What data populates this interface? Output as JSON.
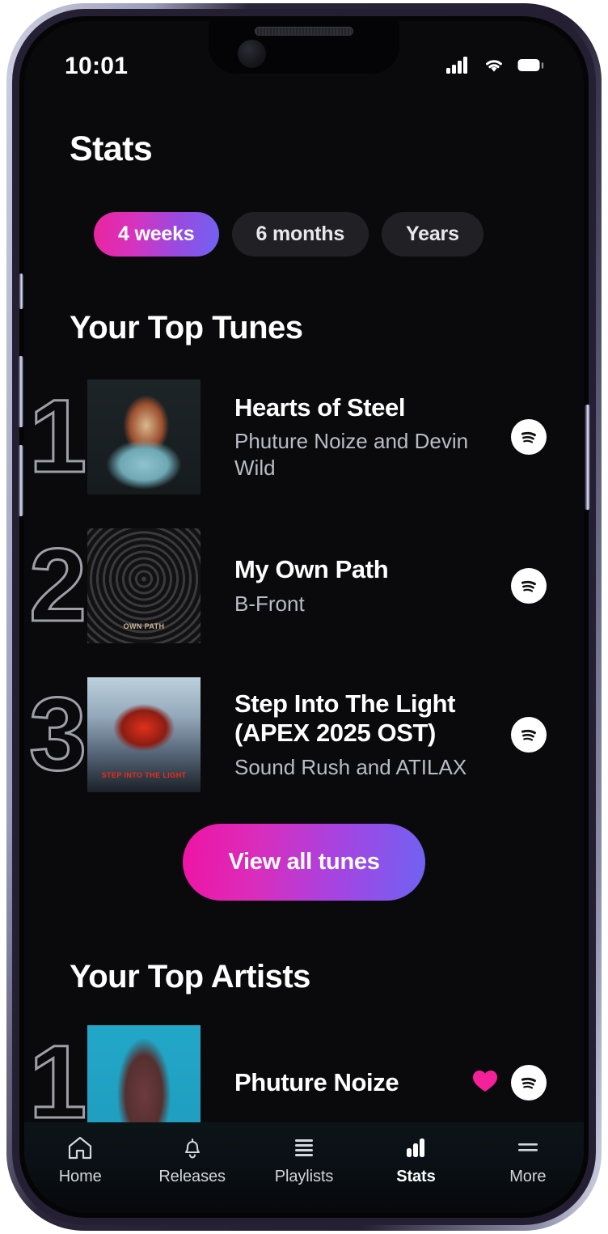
{
  "status_bar": {
    "time": "10:01",
    "icons": [
      "signal-bars-icon",
      "wifi-icon",
      "battery-icon"
    ]
  },
  "header": {
    "title": "Stats"
  },
  "range_filters": {
    "options": [
      {
        "label": "4 weeks",
        "active": true
      },
      {
        "label": "6 months",
        "active": false
      },
      {
        "label": "Years",
        "active": false
      }
    ]
  },
  "top_tunes": {
    "section_title": "Your Top Tunes",
    "tracks": [
      {
        "rank": "1",
        "title": "Hearts of Steel",
        "artist": "Phuture Noize and Devin Wild",
        "artwork_name": "hearts-of-steel-artwork",
        "artwork_caption": "",
        "service_icon": "spotify-icon"
      },
      {
        "rank": "2",
        "title": "My Own Path",
        "artist": "B-Front",
        "artwork_name": "my-own-path-artwork",
        "artwork_caption": "OWN PATH",
        "service_icon": "spotify-icon"
      },
      {
        "rank": "3",
        "title": "Step Into The Light (APEX 2025 OST)",
        "artist": "Sound Rush and ATILAX",
        "artwork_name": "step-into-the-light-artwork",
        "artwork_caption": "STEP INTO THE LIGHT",
        "service_icon": "spotify-icon"
      }
    ],
    "view_all_label": "View all tunes"
  },
  "top_artists": {
    "section_title": "Your Top Artists",
    "artists": [
      {
        "rank": "1",
        "name": "Phuture Noize",
        "artwork_name": "phuture-noize-artwork",
        "favorite_icon": "heart-icon",
        "service_icon": "spotify-icon"
      }
    ]
  },
  "bottom_nav": {
    "items": [
      {
        "label": "Home",
        "icon": "home-icon",
        "active": false
      },
      {
        "label": "Releases",
        "icon": "bell-icon",
        "active": false
      },
      {
        "label": "Playlists",
        "icon": "playlist-lines-icon",
        "active": false
      },
      {
        "label": "Stats",
        "icon": "bar-chart-icon",
        "active": true
      },
      {
        "label": "More",
        "icon": "hamburger-icon",
        "active": false
      }
    ]
  },
  "colors": {
    "accent_pink": "#ef14a4",
    "accent_purple": "#6f63f2",
    "background": "#0a0a0c",
    "heart_pink": "#f5219b",
    "text_primary": "#ffffff",
    "text_secondary": "#b9bcc6"
  }
}
